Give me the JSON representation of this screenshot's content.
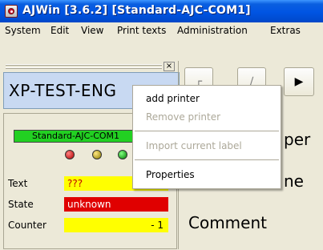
{
  "window": {
    "title": "AJWin [3.6.2]  [Standard-AJC-COM1]",
    "icon": "printer-icon"
  },
  "menubar": {
    "items": [
      "System",
      "Edit",
      "View",
      "Print texts",
      "Administration",
      "Extras"
    ]
  },
  "printer_panel": {
    "name": "XP-TEST-ENG",
    "close_glyph": "×"
  },
  "status": {
    "config_name": "Standard-AJC-COM1",
    "leds": {
      "red": "#d00000",
      "yellow": "#b8a000",
      "green": "#00a000"
    },
    "rows": [
      {
        "label": "Text",
        "value": "???"
      },
      {
        "label": "State",
        "value": "unknown"
      },
      {
        "label": "Counter",
        "value": "-   1"
      }
    ]
  },
  "right_panel": {
    "labels": [
      "per",
      "ne",
      "Comment"
    ],
    "buttons": [
      "┌",
      "∕",
      "▶"
    ]
  },
  "context_menu": {
    "items": [
      {
        "label": "add printer",
        "enabled": true
      },
      {
        "label": "Remove printer",
        "enabled": false
      },
      {
        "label": "Import current label",
        "enabled": false
      },
      {
        "label": "Properties",
        "enabled": true
      }
    ]
  },
  "colors": {
    "titlebar": "#0054e3",
    "status_ok": "#22d022",
    "warning_yellow": "#ffff00",
    "error_red": "#e00000"
  }
}
